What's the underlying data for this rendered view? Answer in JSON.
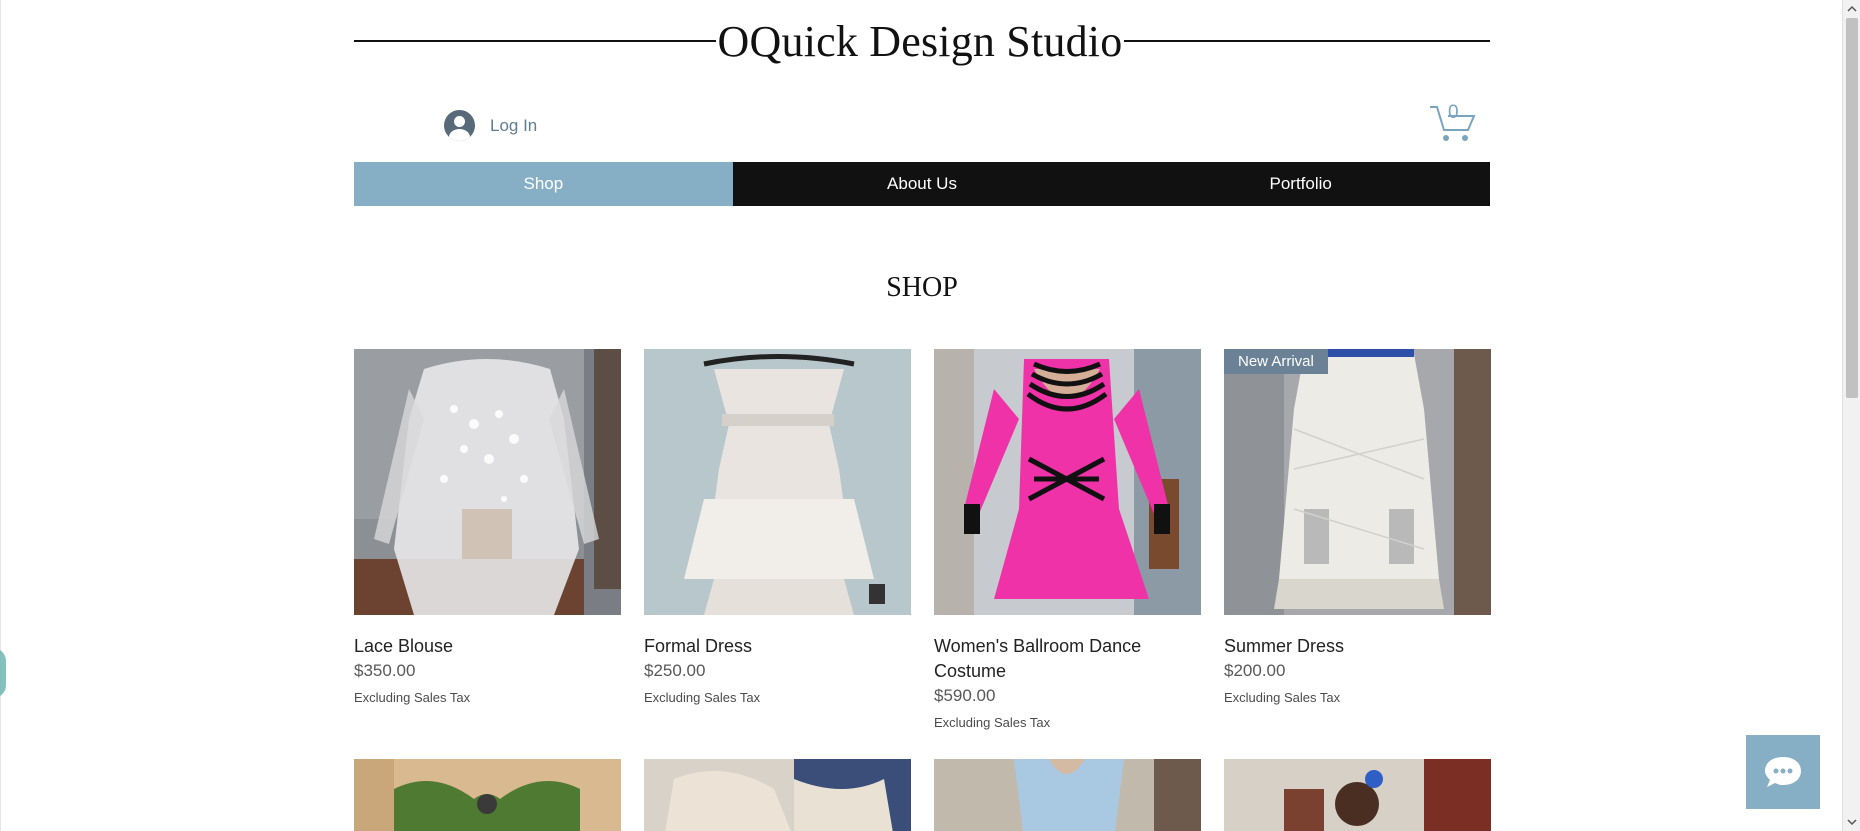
{
  "site": {
    "title": "OQuick Design Studio"
  },
  "login": {
    "label": "Log In"
  },
  "cart": {
    "count": "0"
  },
  "nav": {
    "items": [
      {
        "label": "Shop"
      },
      {
        "label": "About Us"
      },
      {
        "label": "Portfolio"
      }
    ]
  },
  "shop": {
    "heading": "SHOP",
    "products": [
      {
        "name": "Lace Blouse",
        "price": "$350.00",
        "tax_note": "Excluding Sales Tax"
      },
      {
        "name": "Formal Dress",
        "price": "$250.00",
        "tax_note": "Excluding Sales Tax"
      },
      {
        "name": "Women's Ballroom Dance Costume",
        "price": "$590.00",
        "tax_note": "Excluding Sales Tax"
      },
      {
        "name": "Summer Dress",
        "price": "$200.00",
        "tax_note": "Excluding Sales Tax",
        "badge": "New Arrival"
      }
    ]
  },
  "colors": {
    "accent": "#86aec4",
    "nav_bg": "#111111",
    "badge_bg": "#6b8296",
    "link": "#5f7d92"
  },
  "icons": {
    "login": "user-avatar-icon",
    "cart": "shopping-cart-icon",
    "chat": "chat-bubble-icon"
  }
}
